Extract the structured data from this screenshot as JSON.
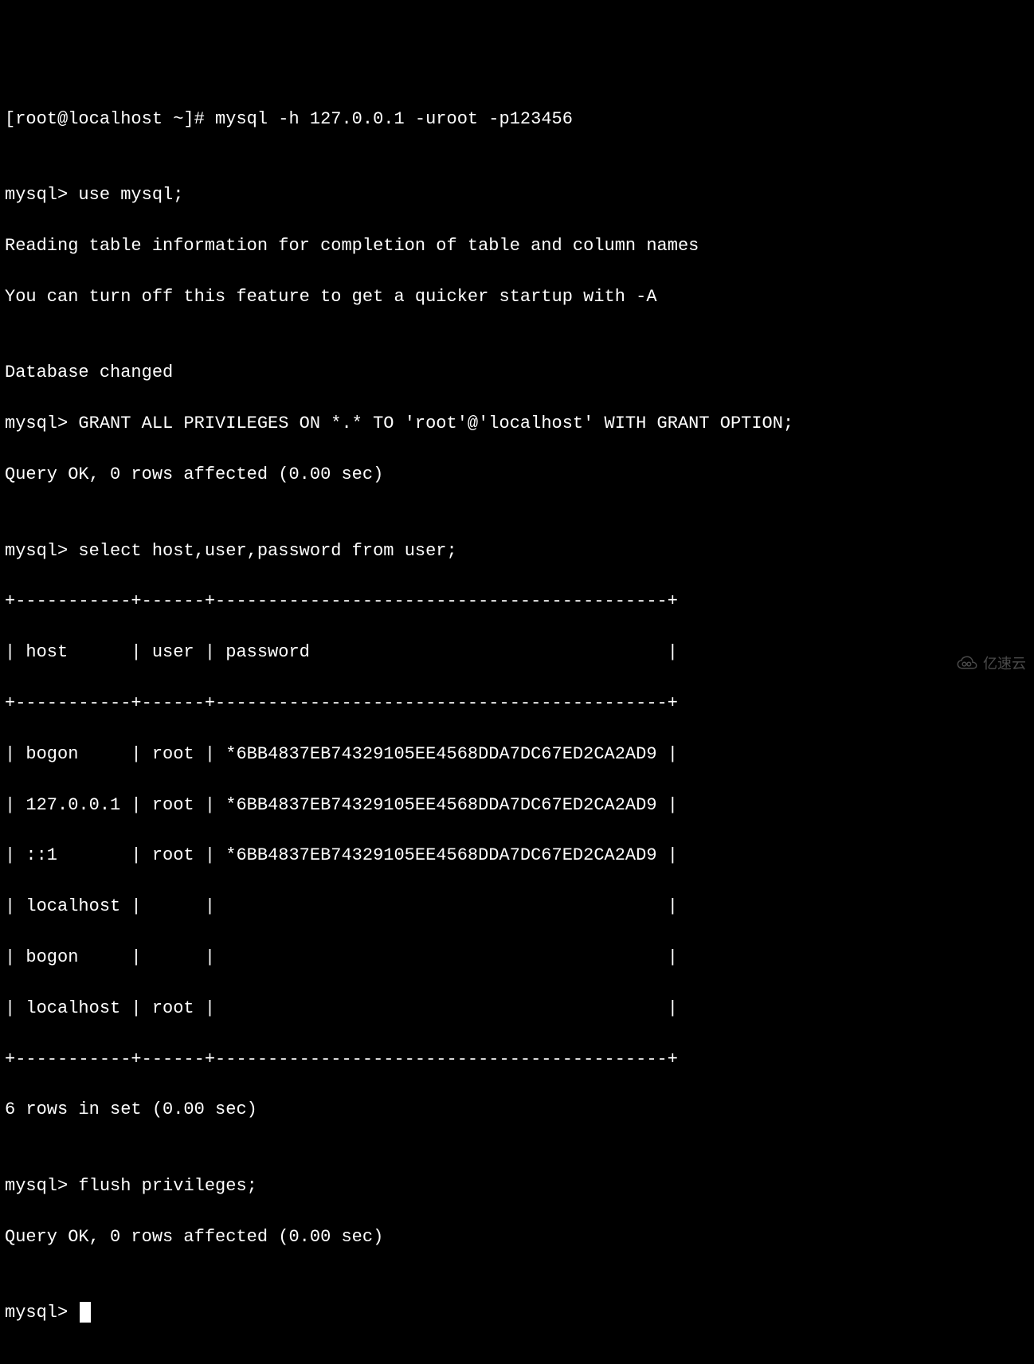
{
  "terminal": {
    "shell_prompt": "[root@localhost ~]# ",
    "shell_command": "mysql -h 127.0.0.1 -uroot -p123456",
    "blank1": "",
    "mysql_prompt": "mysql> ",
    "cmd_use": "use mysql;",
    "reading_info": "Reading table information for completion of table and column names",
    "turnoff_info": "You can turn off this feature to get a quicker startup with -A",
    "blank2": "",
    "db_changed": "Database changed",
    "cmd_grant": "GRANT ALL PRIVILEGES ON *.* TO 'root'@'localhost' WITH GRANT OPTION;",
    "query_ok1": "Query OK, 0 rows affected (0.00 sec)",
    "blank3": "",
    "cmd_select": "select host,user,password from user;",
    "table_border_top": "+-----------+------+-------------------------------------------+",
    "table_header": "| host      | user | password                                  |",
    "table_border_mid": "+-----------+------+-------------------------------------------+",
    "row1": "| bogon     | root | *6BB4837EB74329105EE4568DDA7DC67ED2CA2AD9 |",
    "row2": "| 127.0.0.1 | root | *6BB4837EB74329105EE4568DDA7DC67ED2CA2AD9 |",
    "row3": "| ::1       | root | *6BB4837EB74329105EE4568DDA7DC67ED2CA2AD9 |",
    "row4": "| localhost |      |                                           |",
    "row5": "| bogon     |      |                                           |",
    "row6": "| localhost | root |                                           |",
    "table_border_bot": "+-----------+------+-------------------------------------------+",
    "rows_in_set": "6 rows in set (0.00 sec)",
    "blank4": "",
    "cmd_flush": "flush privileges;",
    "query_ok2": "Query OK, 0 rows affected (0.00 sec)",
    "blank5": "",
    "final_prompt": "mysql> "
  },
  "watermark": {
    "text": "亿速云"
  }
}
